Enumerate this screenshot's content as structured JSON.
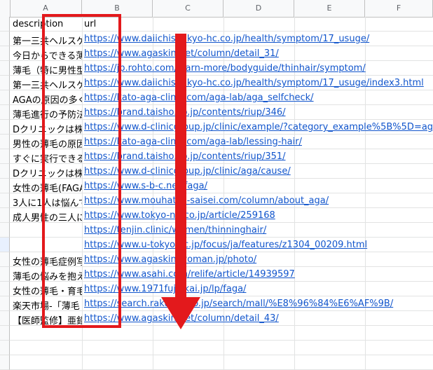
{
  "columns": [
    "A",
    "B",
    "C",
    "D",
    "E",
    "F"
  ],
  "headers": {
    "a": "description",
    "b": "url"
  },
  "rows": [
    {
      "a": "第一三共ヘルスケア",
      "b": "https://www.daiichisankyo-hc.co.jp/health/symptom/17_usuge/"
    },
    {
      "a": "今日からできる薄毛",
      "b": "https://www.agaskin.net/column/detail_31/"
    },
    {
      "a": "薄毛（特に男性型",
      "b": "https://jp.rohto.com/learn-more/bodyguide/thinhair/symptom/"
    },
    {
      "a": "第一三共ヘルスケア",
      "b": "https://www.daiichisankyo-hc.co.jp/health/symptom/17_usuge/index3.html"
    },
    {
      "a": "AGAの原因の多く",
      "b": "https://kato-aga-clinic.com/aga-lab/aga_selfcheck/"
    },
    {
      "a": "薄毛進行の予防法",
      "b": "https://brand.taisho.co.jp/contents/riup/346/"
    },
    {
      "a": "Dクリニックは株式",
      "b": "https://www.d-clinicgroup.jp/clinic/example/?category_example%5B%5D=age40"
    },
    {
      "a": "男性の薄毛の原因",
      "b": "https://kato-aga-clinic.com/aga-lab/lessing-hair/"
    },
    {
      "a": "すぐに実行できる",
      "b": "https://brand.taisho.co.jp/contents/riup/351/"
    },
    {
      "a": "Dクリニックは株式",
      "b": "https://www.d-clinicgroup.jp/clinic/aga/cause/"
    },
    {
      "a": "女性の薄毛(FAGA)",
      "b": "https://www.s-b-c.net/faga/"
    },
    {
      "a": "3人に1人は悩んで",
      "b": "https://www.mouhatsu-saisei.com/column/about_aga/"
    },
    {
      "a": "成人男性の三人に",
      "b": "https://www.tokyo-np.co.jp/article/259168"
    },
    {
      "a": "",
      "b": "https://tenjin.clinic/women/thinninghair/"
    },
    {
      "a": "",
      "b": "https://www.u-tokyo.ac.jp/focus/ja/features/z1304_00209.html"
    },
    {
      "a": "女性の薄毛症例写",
      "b": "https://www.agaskin-woman.jp/photo/"
    },
    {
      "a": "薄毛の悩みを抱え",
      "b": "https://www.asahi.com/relife/article/14939597"
    },
    {
      "a": "女性の薄毛・育毛",
      "b": "https://www.1971fujinkai.jp/lp/faga/"
    },
    {
      "a": "楽天市場-「薄毛",
      "b": "https://search.rakuten.co.jp/search/mall/%E8%96%84%E6%AF%9B/"
    },
    {
      "a": "【医師監修】亜鉛",
      "b": "https://www.agaskin.net/column/detail_43/"
    }
  ]
}
